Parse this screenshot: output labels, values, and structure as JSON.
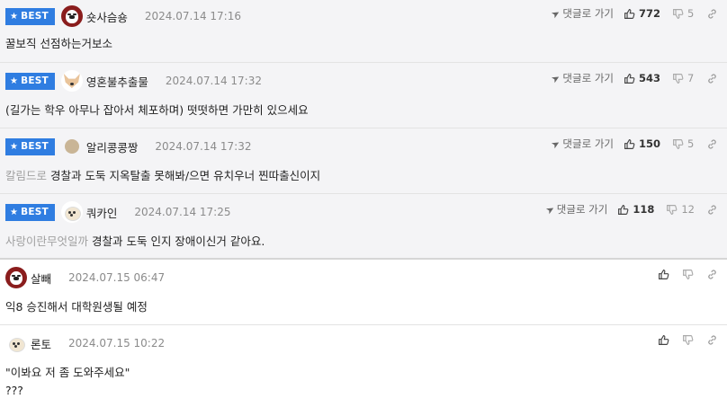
{
  "reply_label": "댓글로 가기",
  "best_label": "BEST",
  "best_comments": [
    {
      "nick": "숏사슴숑",
      "time": "2024.07.14 17:16",
      "text": "꿀보직 선점하는거보소",
      "tag": "",
      "up": "772",
      "down": "5",
      "avatar": "red"
    },
    {
      "nick": "영혼불추출물",
      "time": "2024.07.14 17:32",
      "text": "(길가는 학우 아무나 잡아서 체포하며) 떳떳하면 가만히 있으세요",
      "tag": "",
      "up": "543",
      "down": "7",
      "avatar": "fox"
    },
    {
      "nick": "알리콩콩짱",
      "time": "2024.07.14 17:32",
      "text": "경찰과 도둑 지옥탈출 못해봐/으면 유치우너 찐따출신이지",
      "tag": "칼림드로",
      "up": "150",
      "down": "5",
      "avatar": "dot"
    },
    {
      "nick": "쿼카인",
      "time": "2024.07.14 17:25",
      "text": "경찰과 도둑 인지 장애이신거 같아요.",
      "tag": "사랑이란무엇일까",
      "up": "118",
      "down": "12",
      "avatar": "pup"
    }
  ],
  "comments": [
    {
      "nick": "살빼",
      "time": "2024.07.15 06:47",
      "text": "익8 승진해서 대학원생될 예정",
      "text2": "",
      "avatar": "red"
    },
    {
      "nick": "론토",
      "time": "2024.07.15 10:22",
      "text": "\"이봐요 저 좀 도와주세요\"",
      "text2": "???",
      "avatar": "pup"
    }
  ],
  "colors": {
    "best_badge": "#2f7de1",
    "best_bg": "#f4f4f6",
    "tag_text": "#a0a0a0",
    "time_text": "#8b8b8b"
  },
  "icons": {
    "reply": "send-arrow-icon",
    "up": "thumbs-up-icon",
    "down": "thumbs-down-icon",
    "link": "link-icon",
    "best": "star-icon"
  }
}
